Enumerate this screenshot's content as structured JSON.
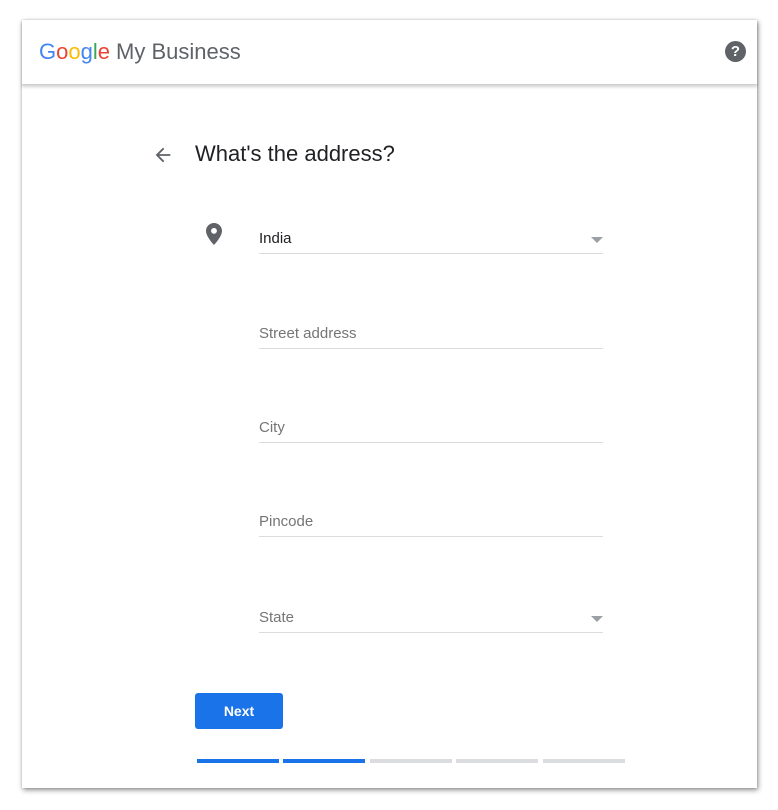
{
  "header": {
    "logo_letters": [
      "G",
      "o",
      "o",
      "g",
      "l",
      "e"
    ],
    "product_name": "My Business",
    "help_icon_glyph": "?"
  },
  "page": {
    "title": "What's the address?"
  },
  "form": {
    "country": {
      "value": "India"
    },
    "street": {
      "placeholder": "Street address"
    },
    "city": {
      "placeholder": "City"
    },
    "pincode": {
      "placeholder": "Pincode"
    },
    "state": {
      "placeholder": "State"
    }
  },
  "actions": {
    "next_label": "Next"
  },
  "progress": {
    "total_steps": 5,
    "completed_steps": 2
  },
  "colors": {
    "primary": "#1a73e8",
    "google_blue": "#4285F4",
    "google_red": "#EA4335",
    "google_yellow": "#FBBC05",
    "google_green": "#34A853",
    "icon_gray": "#5f6368"
  },
  "icons": [
    "help-icon",
    "back-arrow-icon",
    "location-pin-icon",
    "dropdown-arrow-icon"
  ]
}
